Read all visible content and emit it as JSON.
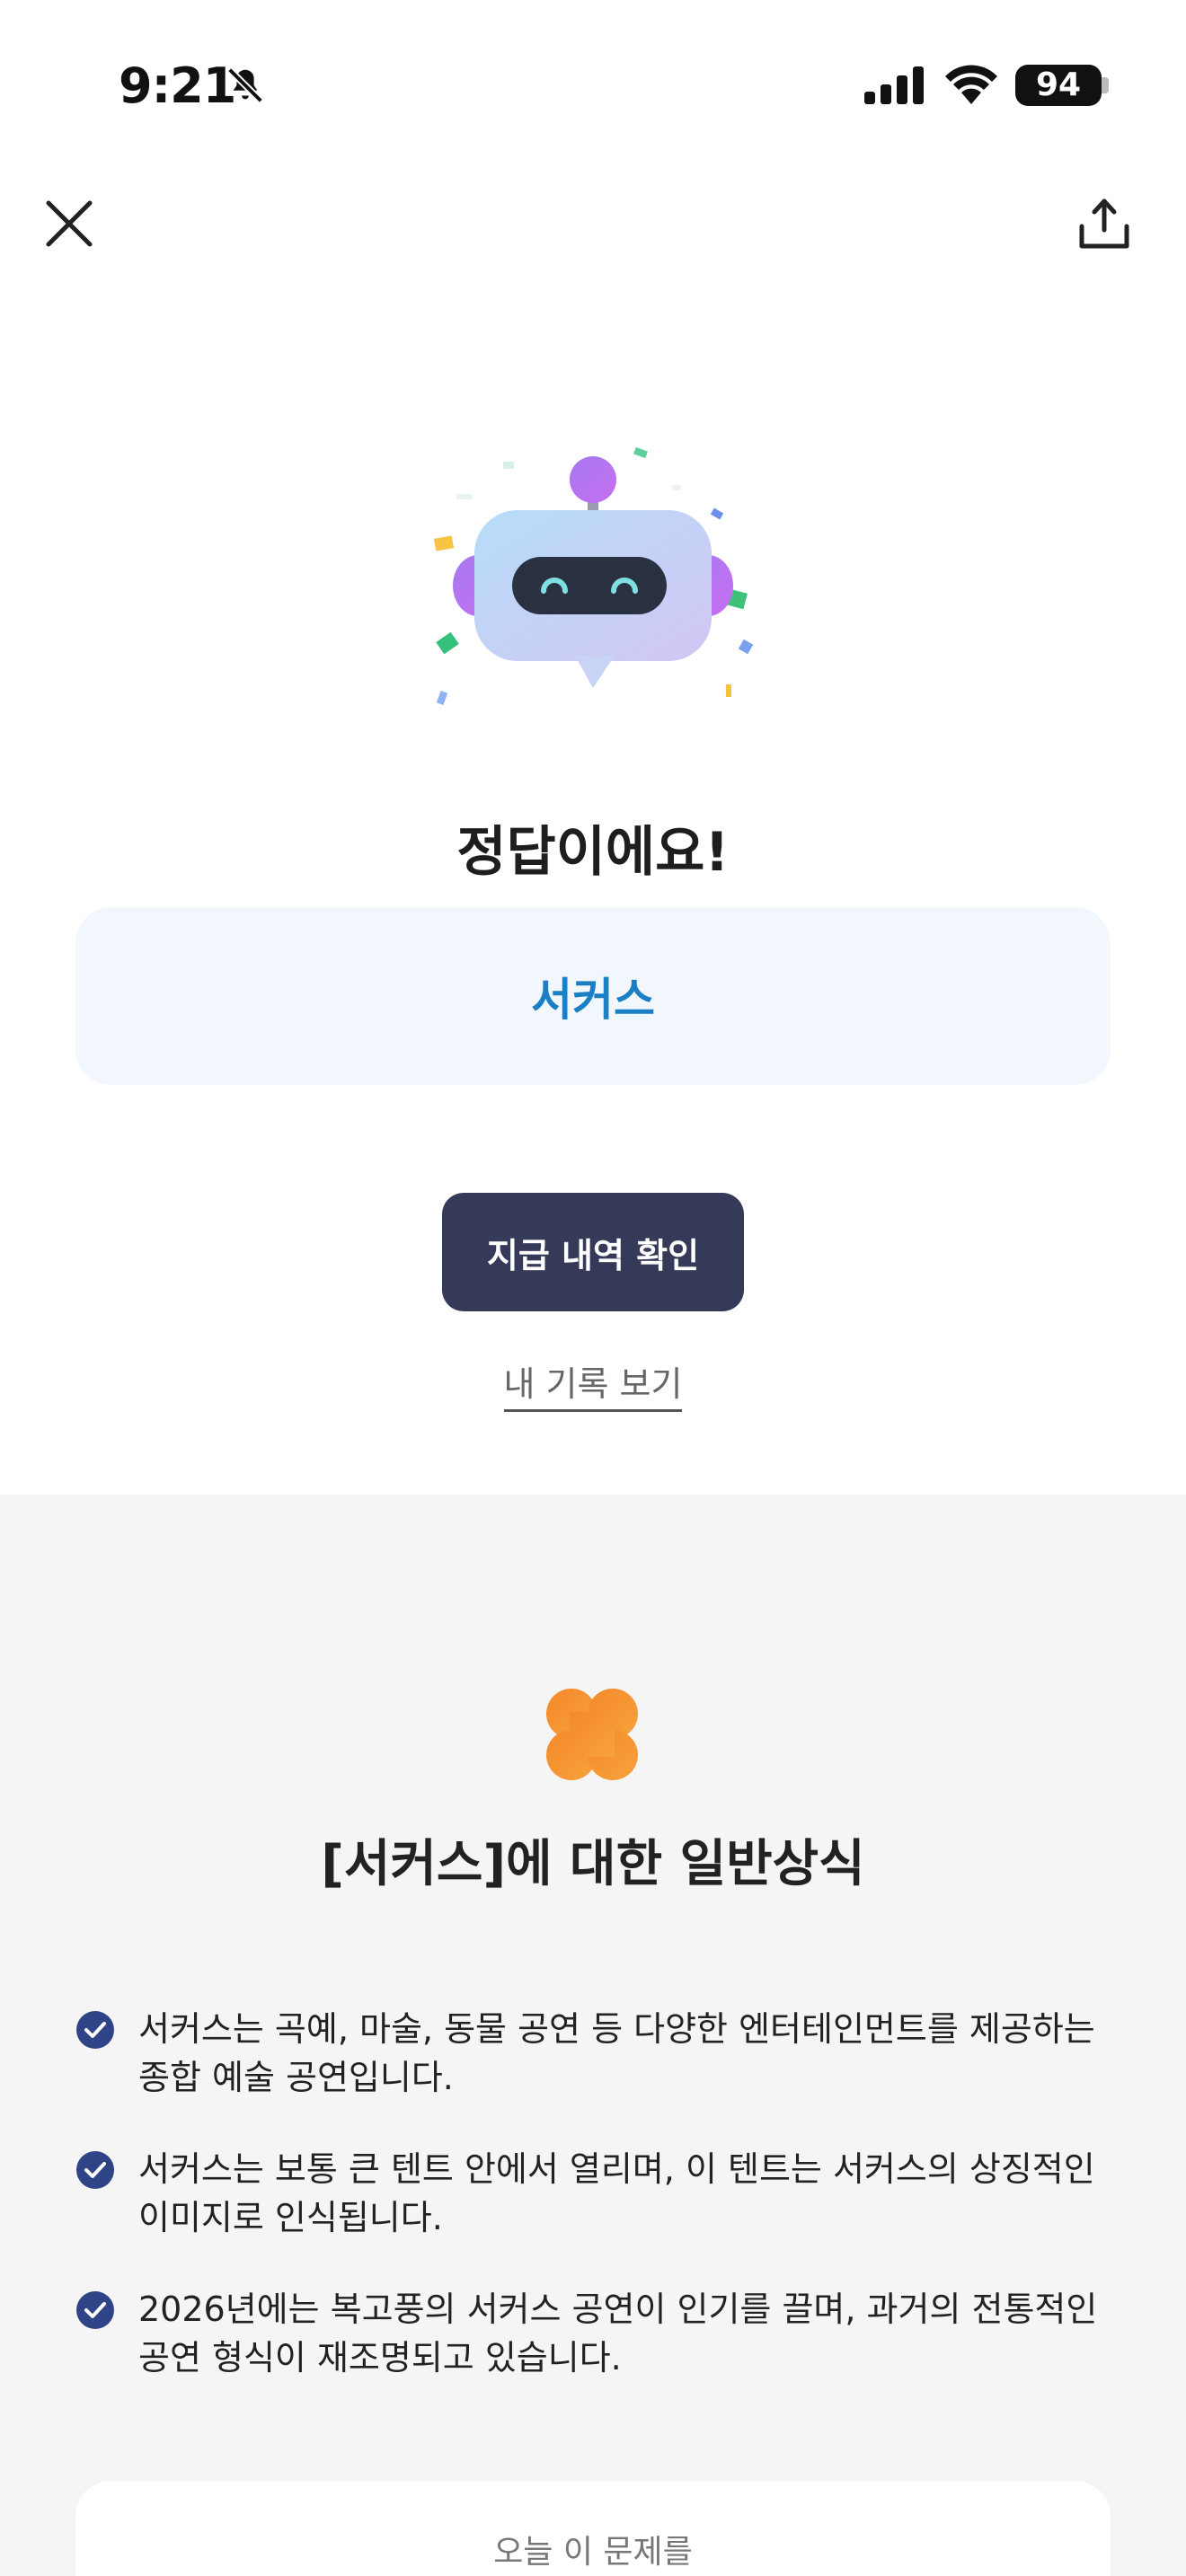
{
  "status": {
    "time": "9:21",
    "battery": "94"
  },
  "result": {
    "title": "정답이에요!",
    "answer": "서커스"
  },
  "actions": {
    "primary_label": "지급 내역 확인",
    "record_label": "내 기록 보기"
  },
  "trivia": {
    "title": "[서커스]에 대한 일반상식",
    "facts": [
      "서커스는 곡예, 마술, 동물 공연 등 다양한 엔터테인먼트를 제공하는 종합 예술 공연입니다.",
      "서커스는 보통 큰 텐트 안에서 열리며, 이 텐트는 서커스의 상징적인 이미지로 인식됩니다.",
      "2026년에는 복고풍의 서커스 공연이 인기를 끌며, 과거의 전통적인 공연 형식이 재조명되고 있습니다."
    ]
  },
  "card": {
    "text": "오늘 이 문제를"
  },
  "colors": {
    "accent": "#1a7fc4",
    "button": "#353a58",
    "clover": "#f5892a",
    "check": "#2f4486"
  }
}
